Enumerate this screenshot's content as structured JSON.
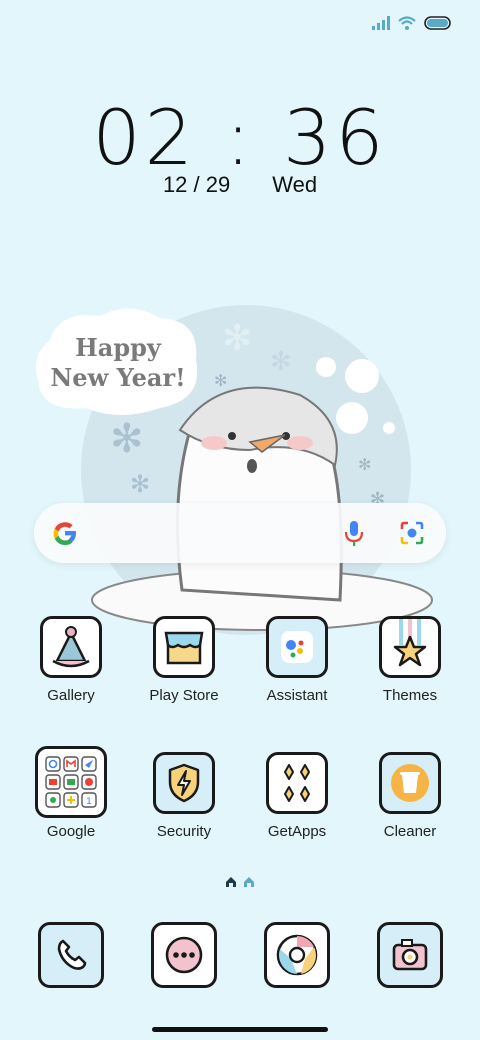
{
  "status": {
    "signal": "signal-icon",
    "wifi": "wifi-icon",
    "battery": "battery-icon"
  },
  "clock": {
    "time": "02 : 36",
    "date": "12 / 29",
    "day": "Wed"
  },
  "wallpaper": {
    "greeting_line1": "Happy",
    "greeting_line2": "New Year!"
  },
  "search": {
    "logo": "google-g-icon",
    "mic": "mic-icon",
    "lens": "lens-icon"
  },
  "apps_row1": [
    {
      "label": "Gallery",
      "icon": "party-hat-icon"
    },
    {
      "label": "Play Store",
      "icon": "store-icon"
    },
    {
      "label": "Assistant",
      "icon": "assistant-icon"
    },
    {
      "label": "Themes",
      "icon": "star-icon"
    }
  ],
  "apps_row2": [
    {
      "label": "Google",
      "icon": "folder-icon"
    },
    {
      "label": "Security",
      "icon": "shield-icon"
    },
    {
      "label": "GetApps",
      "icon": "diamonds-icon"
    },
    {
      "label": "Cleaner",
      "icon": "trash-icon"
    }
  ],
  "dock": [
    {
      "label": "Phone",
      "icon": "phone-icon"
    },
    {
      "label": "Messages",
      "icon": "message-icon"
    },
    {
      "label": "Chrome",
      "icon": "chrome-icon"
    },
    {
      "label": "Camera",
      "icon": "camera-icon"
    }
  ],
  "colors": {
    "background": "#e2f6fc",
    "icon_border": "#1a1a1a",
    "icon_fill_blue": "#d6eef7"
  }
}
